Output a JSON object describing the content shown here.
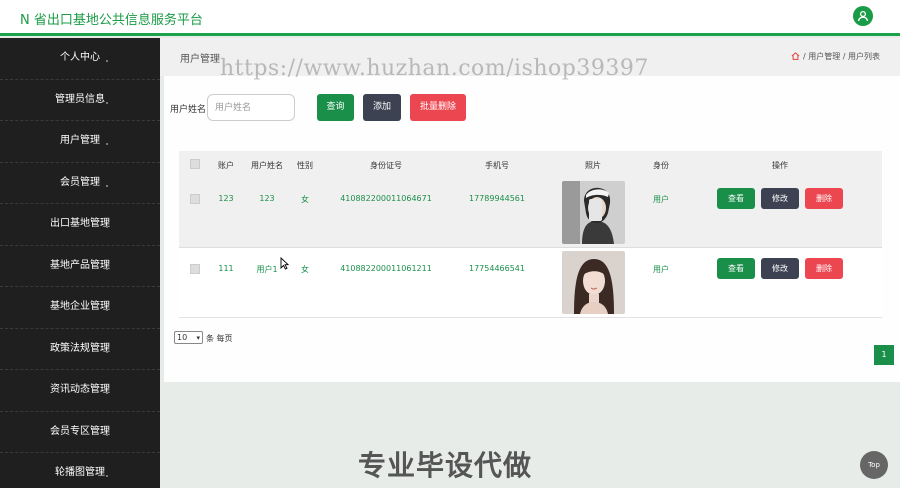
{
  "header": {
    "title": "N 省出口基地公共信息服务平台",
    "avatar_icon": "user-icon"
  },
  "sidebar": {
    "items": [
      {
        "label": "个人中心"
      },
      {
        "label": "管理员信息"
      },
      {
        "label": "用户管理"
      },
      {
        "label": "会员管理"
      },
      {
        "label": "出口基地管理"
      },
      {
        "label": "基地产品管理"
      },
      {
        "label": "基地企业管理"
      },
      {
        "label": "政策法规管理"
      },
      {
        "label": "资讯动态管理"
      },
      {
        "label": "会员专区管理"
      },
      {
        "label": "轮播图管理"
      }
    ]
  },
  "page": {
    "title": "用户管理",
    "breadcrumb": [
      "用户管理",
      "用户列表"
    ],
    "watermark": "https://www.huzhan.com/ishop39397"
  },
  "search": {
    "label": "用户姓名",
    "placeholder": "用户姓名",
    "query_label": "查询",
    "add_label": "添加",
    "batch_delete_label": "批量删除"
  },
  "table": {
    "columns": [
      "账户",
      "用户姓名",
      "性别",
      "身份证号",
      "手机号",
      "照片",
      "身份",
      "操作"
    ],
    "rows": [
      {
        "account": "123",
        "name": "123",
        "gender": "女",
        "id_number": "410882200011064671",
        "phone": "17789944561",
        "role": "用户"
      },
      {
        "account": "111",
        "name": "用户1",
        "gender": "女",
        "id_number": "410882200011061211",
        "phone": "17754466541",
        "role": "用户"
      }
    ],
    "actions": {
      "view": "查看",
      "edit": "修改",
      "delete": "删除"
    }
  },
  "pagination": {
    "page_size": "10",
    "per_page_label": "条 每页",
    "current_page": "1"
  },
  "footer": {
    "promo_text": "专业毕设代做",
    "top_label": "Top"
  },
  "colors": {
    "primary": "#1a8f4a",
    "dark": "#3c4252",
    "danger": "#ec4650",
    "sidebar_bg": "#1f1f1f"
  }
}
